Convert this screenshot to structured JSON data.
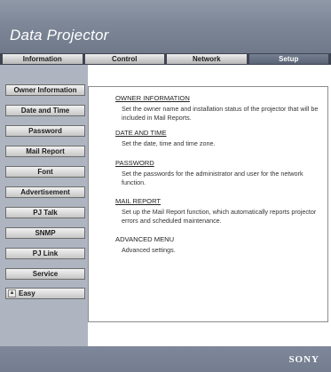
{
  "header": {
    "title": "Data Projector"
  },
  "tabs": [
    {
      "label": "Information",
      "active": false
    },
    {
      "label": "Control",
      "active": false
    },
    {
      "label": "Network",
      "active": false
    },
    {
      "label": "Setup",
      "active": true
    }
  ],
  "sidebar": {
    "items": [
      {
        "label": "Owner Information"
      },
      {
        "label": "Date and Time"
      },
      {
        "label": "Password"
      },
      {
        "label": "Mail Report"
      },
      {
        "label": "Font"
      },
      {
        "label": "Advertisement"
      },
      {
        "label": "PJ Talk"
      },
      {
        "label": "SNMP"
      },
      {
        "label": "PJ Link"
      },
      {
        "label": "Service"
      }
    ],
    "easy": {
      "label": "Easy",
      "icon": "chevron-up-icon"
    }
  },
  "content": {
    "sections": [
      {
        "title": "OWNER INFORMATION",
        "desc": "Set the owner name and installation status of the projector that will be included in Mail Reports."
      },
      {
        "title": "DATE AND TIME",
        "desc": "Set the date, time and time zone."
      },
      {
        "title": "PASSWORD",
        "desc": "Set the passwords for the administrator and user for the network function."
      },
      {
        "title": "MAIL REPORT",
        "desc": "Set up the Mail Report function, which automatically reports projector errors and scheduled maintenance."
      },
      {
        "title": "ADVANCED MENU",
        "desc": "Advanced settings."
      }
    ]
  },
  "footer": {
    "brand": "SONY"
  },
  "colors": {
    "header": "#7d8797",
    "tabbar": "#3e4452",
    "sidebar": "#aeb5c0",
    "active_tab": "#5a6476"
  }
}
